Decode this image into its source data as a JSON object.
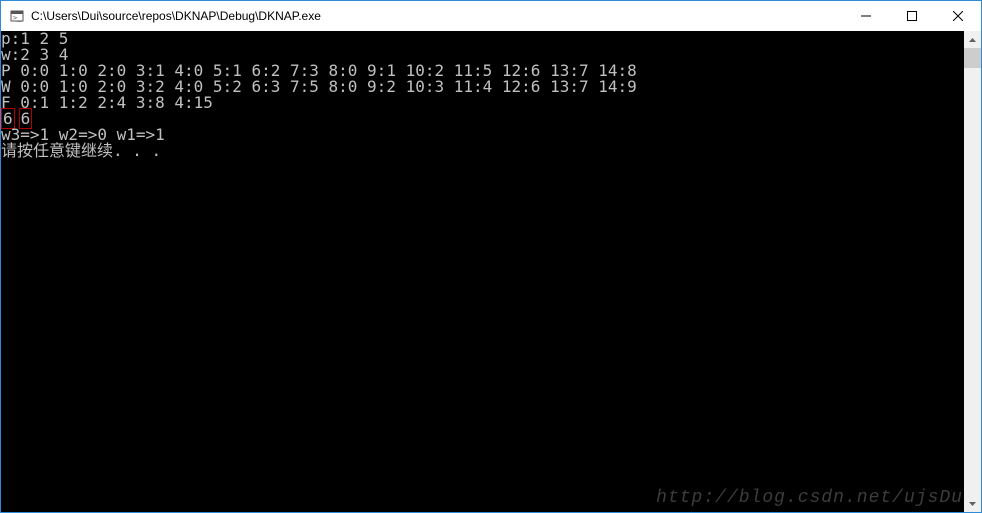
{
  "window": {
    "title": "C:\\Users\\Dui\\source\\repos\\DKNAP\\Debug\\DKNAP.exe"
  },
  "console": {
    "lines": [
      "p:1 2 5",
      "w:2 3 4",
      "P 0:0 1:0 2:0 3:1 4:0 5:1 6:2 7:3 8:0 9:1 10:2 11:5 12:6 13:7 14:8",
      "W 0:0 1:0 2:0 3:2 4:0 5:2 6:3 7:5 8:0 9:2 10:3 11:4 12:6 13:7 14:9",
      "F 0:1 1:2 2:4 3:8 4:15"
    ],
    "highlight": {
      "a": "6",
      "b": "6"
    },
    "lines_after": [
      "w3=>1 w2=>0 w1=>1",
      "请按任意键继续. . ."
    ]
  },
  "watermark": "http://blog.csdn.net/ujsDu"
}
